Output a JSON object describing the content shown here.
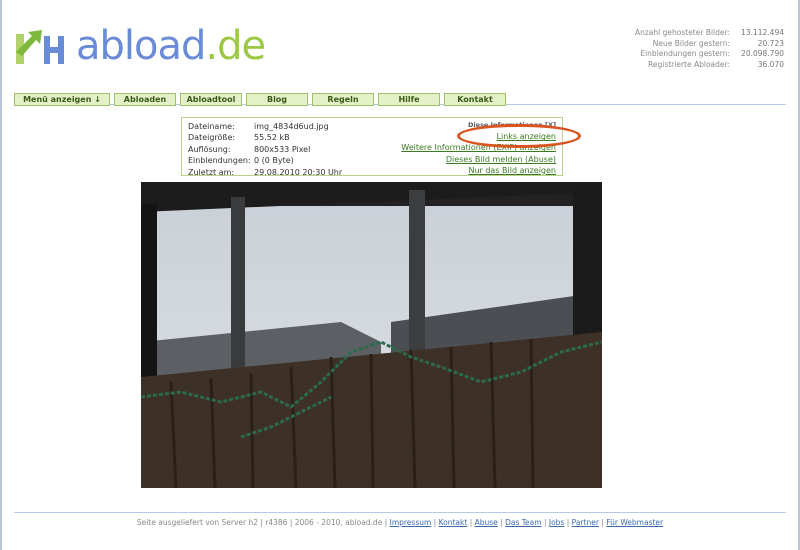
{
  "logo": {
    "word": "abload",
    "tld": ".de"
  },
  "stats": [
    {
      "label": "Anzahl gehosteter Bilder:",
      "value": "13.112.494"
    },
    {
      "label": "Neue Bilder gestern:",
      "value": "20.723"
    },
    {
      "label": "Einblendungen gestern:",
      "value": "20.098.790"
    },
    {
      "label": "Registrierte Abloader:",
      "value": "36.070"
    }
  ],
  "nav": [
    {
      "label": "Menü anzeigen ↓"
    },
    {
      "label": "Abloaden"
    },
    {
      "label": "Abloadtool"
    },
    {
      "label": "Blog"
    },
    {
      "label": "Regeln"
    },
    {
      "label": "Hilfe"
    },
    {
      "label": "Kontakt"
    }
  ],
  "info": {
    "rows": [
      {
        "key": "Dateiname:",
        "value": "img_4834d6ud.jpg"
      },
      {
        "key": "Dateigröße:",
        "value": "55.52 kB"
      },
      {
        "key": "Auflösung:",
        "value": "800x533 Pixel"
      },
      {
        "key": "Einblendungen:",
        "value": "0 (0 Byte)"
      },
      {
        "key": "Zuletzt am:",
        "value": "29.08.2010 20:30 Uhr"
      }
    ],
    "hint": "Diese Informationen [X]",
    "links": [
      "Links anzeigen",
      "Weitere Informationen (EXIF) anzeigen",
      "Dieses Bild melden (Abuse)",
      "Nur das Bild anzeigen"
    ]
  },
  "footer": {
    "text": "Seite ausgeliefert von Server h2 | r4386 | 2006 - 2010, abload.de |",
    "links": [
      "Impressum",
      "Kontakt",
      "Abuse",
      "Das Team",
      "Jobs",
      "Partner",
      "Für Webmaster"
    ]
  },
  "colors": {
    "logo_blue": "#6a8bd6",
    "logo_green": "#9bc845",
    "highlight": "#d9541e"
  }
}
